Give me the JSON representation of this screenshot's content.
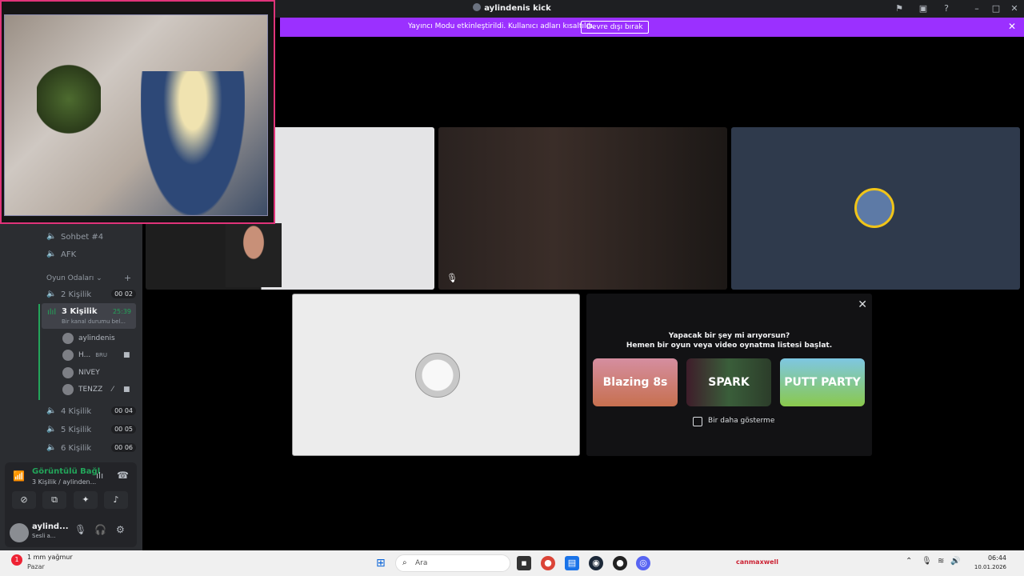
{
  "window": {
    "title": "aylindenis kick"
  },
  "banner": {
    "message": "Yayıncı Modu etkinleştirildi. Kullanıcı adları kısaltıldı.",
    "button": "Devre dışı bırak"
  },
  "sidebar": {
    "channels_top": [
      {
        "label": "Sohbet #4"
      },
      {
        "label": "AFK"
      }
    ],
    "category": "Oyun Odaları",
    "channels": [
      {
        "label": "2 Kişilik",
        "badge_a": "00",
        "badge_b": "02"
      },
      {
        "label": "4 Kişilik",
        "badge_a": "00",
        "badge_b": "04"
      },
      {
        "label": "5 Kişilik",
        "badge_a": "00",
        "badge_b": "05"
      },
      {
        "label": "6 Kişilik",
        "badge_a": "00",
        "badge_b": "06"
      }
    ],
    "active_channel": {
      "label": "3 Kişilik",
      "time": "25:39",
      "status": "Bir kanal durumu bel..."
    },
    "voice_users": [
      {
        "name": "aylindenis"
      },
      {
        "name": "H...",
        "extra": "BRU"
      },
      {
        "name": "NIVEY"
      },
      {
        "name": "TENZZ"
      }
    ]
  },
  "voice_panel": {
    "title": "Görüntülü Bağl",
    "subtitle": "3 Kişilik / aylinden..."
  },
  "user_bar": {
    "name": "aylind...",
    "status": "Sesli a..."
  },
  "activity": {
    "line1": "Yapacak bir şey mi arıyorsun?",
    "line2": "Hemen bir oyun veya video oynatma listesi başlat.",
    "games": [
      {
        "name": "Blazing 8s"
      },
      {
        "name": "SPARK"
      },
      {
        "name": "PUTT PARTY"
      }
    ],
    "checkbox_label": "Bir daha gösterme"
  },
  "taskbar": {
    "weather_temp": "1 mm yağmur",
    "weather_sub": "Pazar",
    "search_placeholder": "Ara",
    "watermark": "canmaxwell",
    "time": "06:44",
    "date": "10.01.2026"
  },
  "colors": {
    "banner": "#9b30ff",
    "accent_green": "#23a55a",
    "cam_border": "#e0337a"
  }
}
